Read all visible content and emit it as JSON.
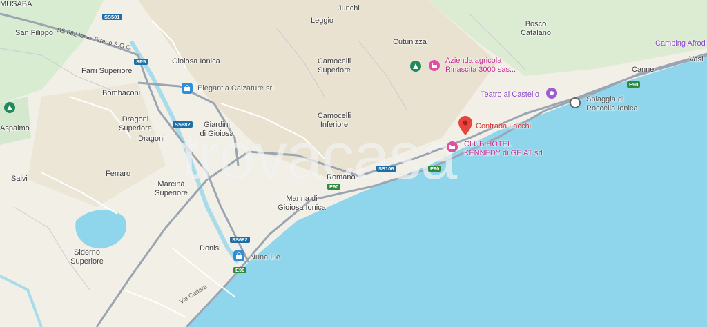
{
  "places": {
    "musaba": "MUSABA",
    "san_filippo": "San Filippo",
    "farri_superiore": "Farri Superiore",
    "bombaconi": "Bombaconi",
    "aspalmo": "Aspalmo",
    "dragoni_superiore": "Dragoni\nSuperiore",
    "dragoni": "Dragoni",
    "ferraro": "Ferraro",
    "salvi": "Salvi",
    "marcina_superiore": "Marcinà\nSuperiore",
    "siderno_superiore": "Siderno\nSuperiore",
    "donisi": "Donisi",
    "gioiosa_ionica": "Gioiosa Ionica",
    "giardini": "Giardini\ndi Gioiosa",
    "leggio": "Leggio",
    "junchi": "Junchi",
    "camocelli_superiore": "Camocelli\nSuperiore",
    "camocelli_inferiore": "Camocelli\nInferiore",
    "cutunizza": "Cutunizza",
    "romano": "Romano",
    "marina": "Marina di\nGioiosa Ionica",
    "bosco_catalano": "Bosco\nCatalano",
    "canne": "Canne",
    "vasi": "Vasi"
  },
  "pois": {
    "elegantia": "Elegantia Calzature srl",
    "azienda": "Azienda agricola\nRinascita 3000 sas...",
    "teatro": "Teatro al Castello",
    "spiaggia": "Spiaggia di\nRoccella Ionica",
    "contrada": "Contrada Lacchi",
    "club_hotel": "CLUB HOTEL\nKENNEDY di GE AT srl",
    "camping": "Camping Afrod",
    "nuna_lie": "Nuna Lie"
  },
  "roads": {
    "ss501": "SS501",
    "ss682_ionio": "SS 682 Ionio Tirreno S.G.C.",
    "sp5": "SP5",
    "ss682_a": "SS682",
    "ss682_b": "SS682",
    "ss106": "SS106",
    "e90_a": "E90",
    "e90_b": "E90",
    "e90_c": "E90",
    "e90_d": "E90",
    "via_cadara": "Via Cadara"
  },
  "watermark": "trovacasa",
  "colors": {
    "sea": "#8fd6ec",
    "land": "#f2efe6",
    "hill": "#e8e2d3",
    "green": "#d9eed4",
    "road": "#9aa4b2",
    "pin": "#e8453c"
  },
  "icons": {
    "pin": "map-pin-icon",
    "hotel": "hotel-icon",
    "camping": "camping-icon",
    "shopping": "shopping-bag-icon",
    "attraction": "attraction-icon",
    "beach": "beach-icon"
  }
}
